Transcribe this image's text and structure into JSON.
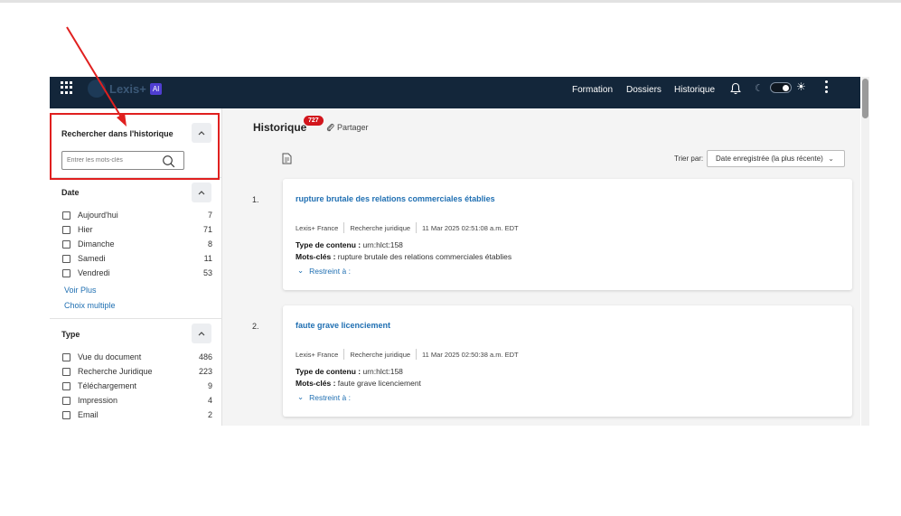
{
  "header": {
    "logo_text": "Lexis+",
    "logo_ai": "AI",
    "nav": [
      "Formation",
      "Dossiers",
      "Historique"
    ]
  },
  "sidebar": {
    "search": {
      "title": "Rechercher dans l'historique",
      "placeholder": "Entrer les mots-clés"
    },
    "date": {
      "title": "Date",
      "items": [
        {
          "label": "Aujourd'hui",
          "count": "7"
        },
        {
          "label": "Hier",
          "count": "71"
        },
        {
          "label": "Dimanche",
          "count": "8"
        },
        {
          "label": "Samedi",
          "count": "11"
        },
        {
          "label": "Vendredi",
          "count": "53"
        }
      ],
      "voir_plus": "Voir Plus",
      "choix_multiple": "Choix multiple"
    },
    "type": {
      "title": "Type",
      "items": [
        {
          "label": "Vue du document",
          "count": "486"
        },
        {
          "label": "Recherche Juridique",
          "count": "223"
        },
        {
          "label": "Téléchargement",
          "count": "9"
        },
        {
          "label": "Impression",
          "count": "4"
        },
        {
          "label": "Email",
          "count": "2"
        }
      ]
    }
  },
  "main": {
    "title": "Historique",
    "badge": "727",
    "share": "Partager",
    "sort_label": "Trier par:",
    "sort_value": "Date enregistrée (la plus récente)",
    "results": [
      {
        "num": "1.",
        "title": "rupture brutale des relations commerciales établies",
        "meta": [
          "Lexis+ France",
          "Recherche juridique",
          "11 Mar 2025 02:51:08 a.m. EDT"
        ],
        "type_label": "Type de contenu :",
        "type_value": "urn:hlct:158",
        "keywords_label": "Mots-clés :",
        "keywords_value": "rupture brutale des relations commerciales établies",
        "restrict": "Restreint à :"
      },
      {
        "num": "2.",
        "title": "faute grave licenciement",
        "meta": [
          "Lexis+ France",
          "Recherche juridique",
          "11 Mar 2025 02:50:38 a.m. EDT"
        ],
        "type_label": "Type de contenu :",
        "type_value": "urn:hlct:158",
        "keywords_label": "Mots-clés :",
        "keywords_value": "faute grave licenciement",
        "restrict": "Restreint à :"
      }
    ]
  },
  "colors": {
    "header_bg": "#13263a",
    "link": "#1f6fb2",
    "badge": "#d2151c",
    "annotation": "#e0201f"
  }
}
